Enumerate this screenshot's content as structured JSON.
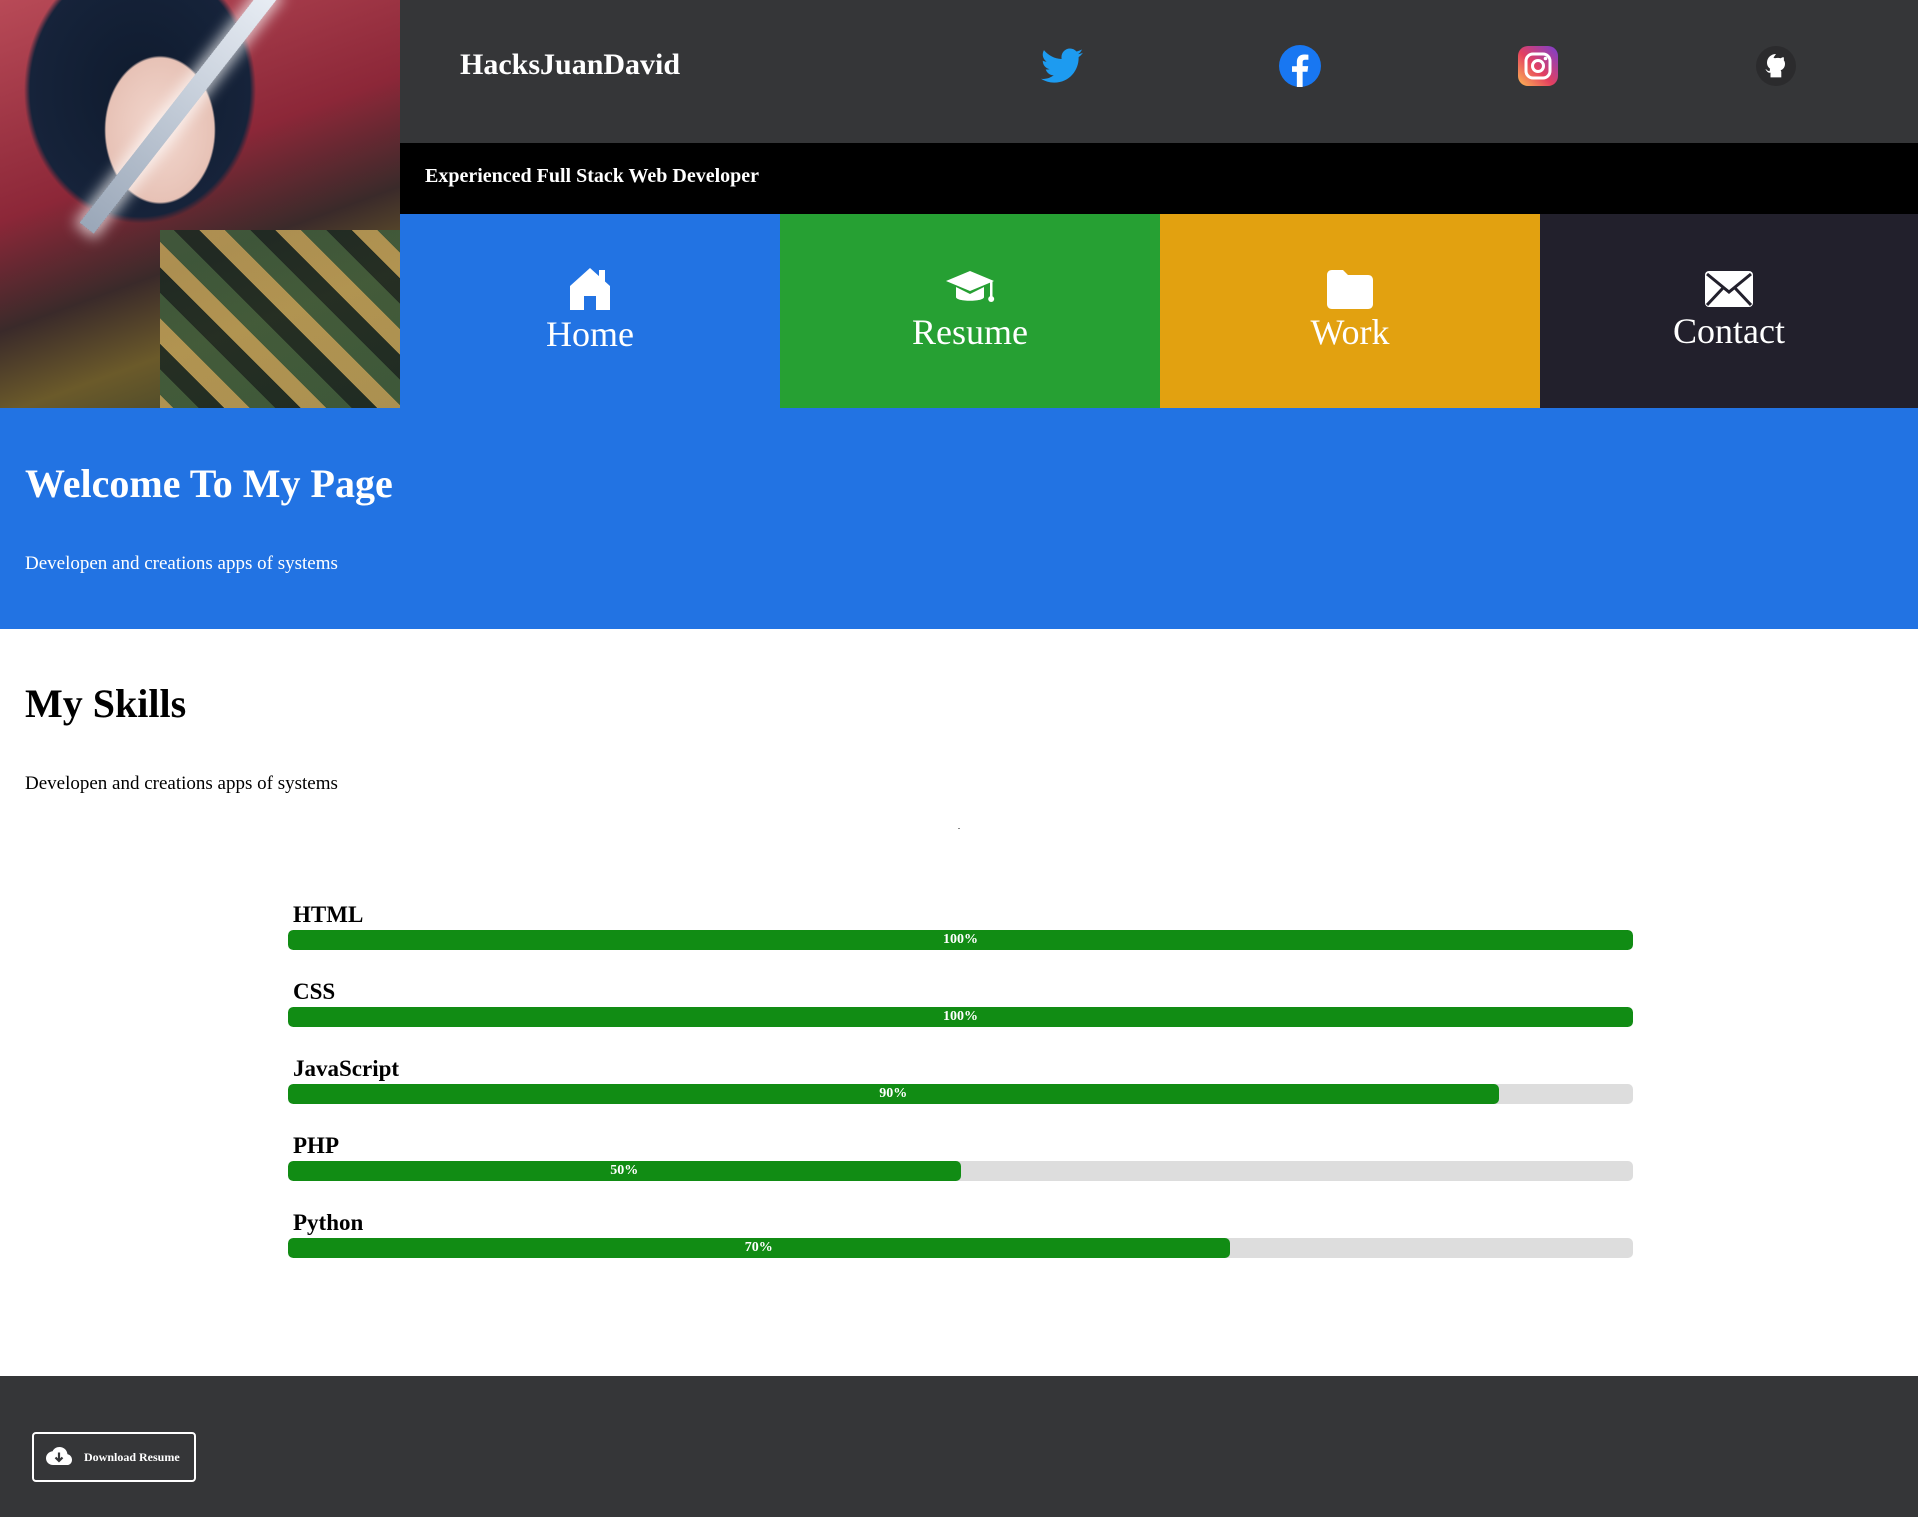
{
  "header": {
    "brand": "HacksJuanDavid",
    "tagline": "Experienced Full Stack Web Developer",
    "social": [
      {
        "icon": "twitter-icon",
        "color": "#1d9bf0"
      },
      {
        "icon": "facebook-icon",
        "color": "#1877f2"
      },
      {
        "icon": "instagram-icon",
        "color": "#e4405f"
      },
      {
        "icon": "github-icon",
        "color": "#ffffff"
      }
    ]
  },
  "nav": [
    {
      "label": "Home",
      "icon": "home-icon",
      "color": "#2273e3"
    },
    {
      "label": "Resume",
      "icon": "graduation-cap-icon",
      "color": "#26a033"
    },
    {
      "label": "Work",
      "icon": "folder-icon",
      "color": "#e2a110"
    },
    {
      "label": "Contact",
      "icon": "envelope-icon",
      "color": "#22202c"
    }
  ],
  "hero": {
    "title": "Welcome To My Page",
    "subtitle": "Developen and creations apps of systems",
    "background": "#2273e3"
  },
  "skills": {
    "title": "My Skills",
    "subtitle": "Developen and creations apps of systems",
    "items": [
      {
        "name": "HTML",
        "percent": 100,
        "label": "100%"
      },
      {
        "name": "CSS",
        "percent": 100,
        "label": "100%"
      },
      {
        "name": "JavaScript",
        "percent": 90,
        "label": "90%"
      },
      {
        "name": "PHP",
        "percent": 50,
        "label": "50%"
      },
      {
        "name": "Python",
        "percent": 70,
        "label": "70%"
      }
    ],
    "bar_color": "#118c14",
    "track_color": "#dddddd"
  },
  "footer": {
    "download_label": "Download Resume",
    "download_icon": "cloud-download-icon"
  }
}
